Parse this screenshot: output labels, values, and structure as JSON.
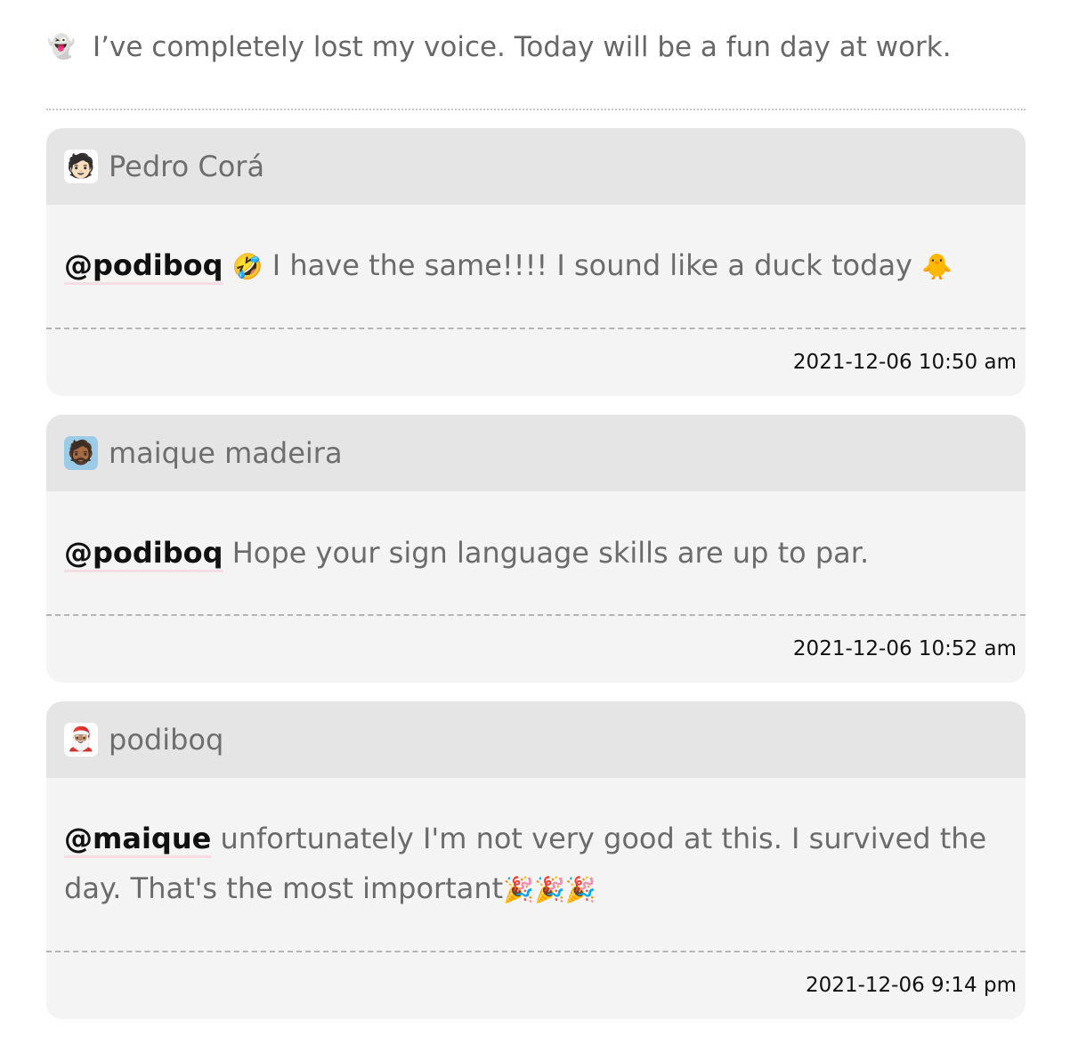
{
  "post": {
    "emoji": "👻",
    "text": "I’ve completely lost my voice. Today will be a fun day at work."
  },
  "comments": [
    {
      "author": "Pedro Corá",
      "avatar": "🧑🏻",
      "mention": "@podiboq",
      "emoji_a": "🤣",
      "text": " I have the same!!!! I sound like a duck today ",
      "emoji_b": "🐥",
      "timestamp": "2021-12-06 10:50 am"
    },
    {
      "author": "maique madeira",
      "avatar": "🧔🏾",
      "mention": "@podiboq",
      "text": " Hope your sign language skills are up to par.",
      "timestamp": "2021-12-06 10:52 am"
    },
    {
      "author": "podiboq",
      "avatar": "🎅🏽",
      "mention": "@maique",
      "text": " unfortunately I'm not very good at this. I survived the day. That's the most important",
      "emoji_a": "🎉🎉🎉",
      "timestamp": "2021-12-06 9:14 pm"
    }
  ]
}
